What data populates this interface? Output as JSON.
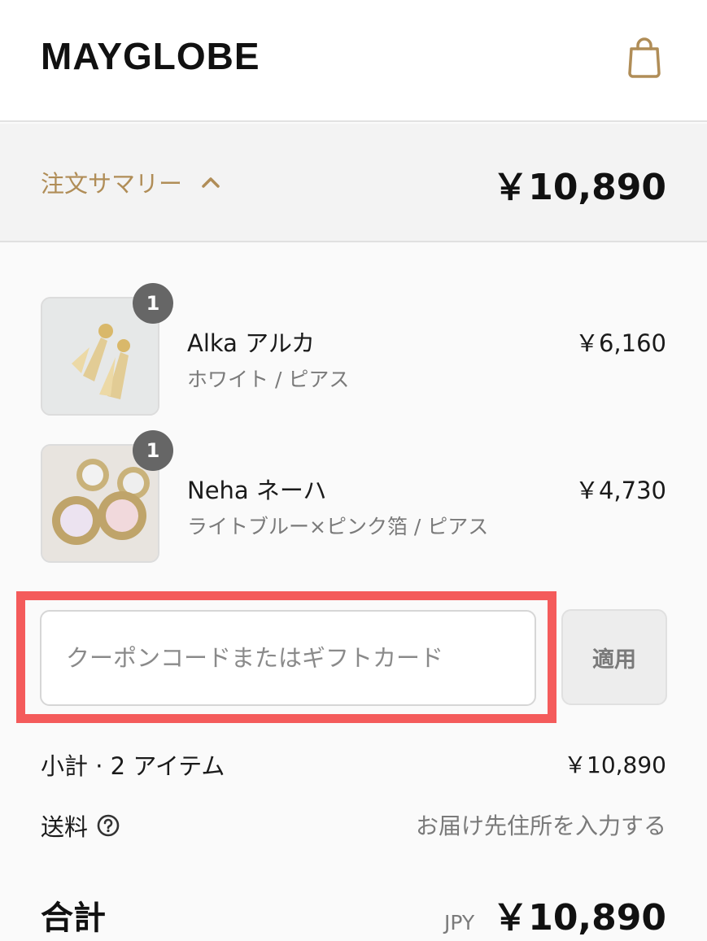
{
  "header": {
    "brand": "MAYGLOBE",
    "cart_icon": "shopping-bag-icon"
  },
  "summary": {
    "toggle_label": "注文サマリー",
    "chevron_icon": "chevron-up-icon",
    "total": "￥10,890"
  },
  "items": [
    {
      "quantity": "1",
      "name": "Alka アルカ",
      "variant": "ホワイト / ピアス",
      "price": "￥6,160",
      "image": "tassel-earrings-image"
    },
    {
      "quantity": "1",
      "name": "Neha ネーハ",
      "variant": "ライトブルー×ピンク箔 / ピアス",
      "price": "￥4,730",
      "image": "crystal-earrings-image"
    }
  ],
  "coupon": {
    "placeholder": "クーポンコードまたはギフトカード",
    "apply_label": "適用"
  },
  "subtotal": {
    "label": "小計 · 2 アイテム",
    "value": "￥10,890"
  },
  "shipping": {
    "label": "送料",
    "help_icon": "question-circle-icon",
    "value": "お届け先住所を入力する"
  },
  "total": {
    "label": "合計",
    "currency": "JPY",
    "value": "￥10,890"
  },
  "colors": {
    "accent": "#b08d57",
    "highlight": "#f45b5b"
  }
}
